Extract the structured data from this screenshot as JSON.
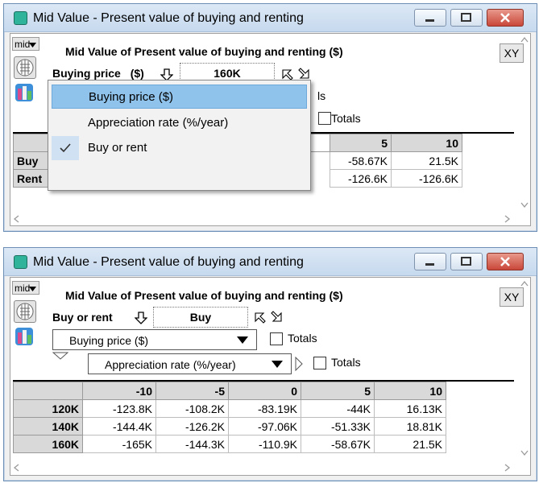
{
  "window1": {
    "title": "Mid Value - Present value of buying and renting",
    "mid_label": "mid",
    "xy_label": "XY",
    "heading": "Mid Value of Present value of buying and renting ($)",
    "index_label": "Buying price",
    "index_unit": "($)",
    "index_value": "160K",
    "partial_label": "ls",
    "totals_label": "Totals",
    "menu": {
      "items": [
        {
          "label": "Buying price ($)",
          "selected": true,
          "checked": false
        },
        {
          "label": "Appreciation rate (%/year)",
          "selected": false,
          "checked": false
        },
        {
          "label": "Buy or rent",
          "selected": false,
          "checked": true
        }
      ]
    },
    "table": {
      "col_headers": [
        "5",
        "10"
      ],
      "rows": [
        {
          "label": "Buy",
          "values": [
            "-58.67K",
            "21.5K"
          ]
        },
        {
          "label": "Rent",
          "values": [
            "-126.6K",
            "-126.6K"
          ]
        }
      ]
    }
  },
  "window2": {
    "title": "Mid Value - Present value of buying and renting",
    "mid_label": "mid",
    "xy_label": "XY",
    "heading": "Mid Value of Present value of buying and renting ($)",
    "index_label": "Buy or rent",
    "index_value": "Buy",
    "row_dropdown": "Buying price ($)",
    "col_dropdown": "Appreciation rate (%/year)",
    "totals_label": "Totals",
    "table": {
      "col_headers": [
        "-10",
        "-5",
        "0",
        "5",
        "10"
      ],
      "rows": [
        {
          "label": "120K",
          "values": [
            "-123.8K",
            "-108.2K",
            "-83.19K",
            "-44K",
            "16.13K"
          ]
        },
        {
          "label": "140K",
          "values": [
            "-144.4K",
            "-126.2K",
            "-97.06K",
            "-51.33K",
            "18.81K"
          ]
        },
        {
          "label": "160K",
          "values": [
            "-165K",
            "-144.3K",
            "-110.9K",
            "-58.67K",
            "21.5K"
          ]
        }
      ]
    }
  }
}
